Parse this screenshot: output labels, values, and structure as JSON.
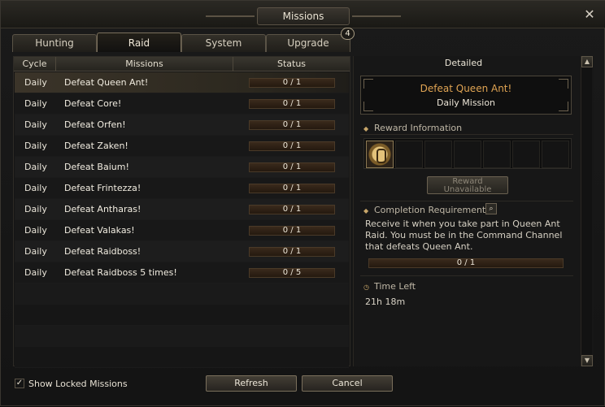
{
  "window": {
    "title": "Missions"
  },
  "tabs": [
    {
      "label": "Hunting"
    },
    {
      "label": "Raid",
      "active": true
    },
    {
      "label": "System"
    },
    {
      "label": "Upgrade",
      "badge": "4"
    }
  ],
  "list": {
    "headers": {
      "cycle": "Cycle",
      "missions": "Missions",
      "status": "Status"
    },
    "rows": [
      {
        "cycle": "Daily",
        "mission": "Defeat Queen Ant!",
        "status": "0 / 1"
      },
      {
        "cycle": "Daily",
        "mission": "Defeat Core!",
        "status": "0 / 1"
      },
      {
        "cycle": "Daily",
        "mission": "Defeat Orfen!",
        "status": "0 / 1"
      },
      {
        "cycle": "Daily",
        "mission": "Defeat Zaken!",
        "status": "0 / 1"
      },
      {
        "cycle": "Daily",
        "mission": "Defeat Baium!",
        "status": "0 / 1"
      },
      {
        "cycle": "Daily",
        "mission": "Defeat Frintezza!",
        "status": "0 / 1"
      },
      {
        "cycle": "Daily",
        "mission": "Defeat Antharas!",
        "status": "0 / 1"
      },
      {
        "cycle": "Daily",
        "mission": "Defeat Valakas!",
        "status": "0 / 1"
      },
      {
        "cycle": "Daily",
        "mission": "Defeat Raidboss!",
        "status": "0 / 1"
      },
      {
        "cycle": "Daily",
        "mission": "Defeat Raidboss 5 times!",
        "status": "0 / 5"
      }
    ]
  },
  "detail": {
    "title": "Detailed",
    "mission_name": "Defeat Queen Ant!",
    "mission_type": "Daily Mission",
    "reward_header": "Reward Information",
    "reward_button": "Reward Unavailable",
    "requirements_header": "Completion Requirements",
    "requirements_text": "Receive it when you take part in Queen Ant Raid. You must be in the Command Channel that defeats Queen Ant.",
    "progress": "0 / 1",
    "time_header": "Time Left",
    "time_value": "21h 18m"
  },
  "bottom": {
    "show_locked": "Show Locked Missions",
    "refresh": "Refresh",
    "cancel": "Cancel"
  },
  "icons": {
    "close": "close-icon",
    "check": "checkmark-icon",
    "search": "magnifier-icon",
    "scroll_up": "arrow-up-icon",
    "scroll_down": "arrow-down-icon",
    "reward": "reward-medal-icon"
  }
}
